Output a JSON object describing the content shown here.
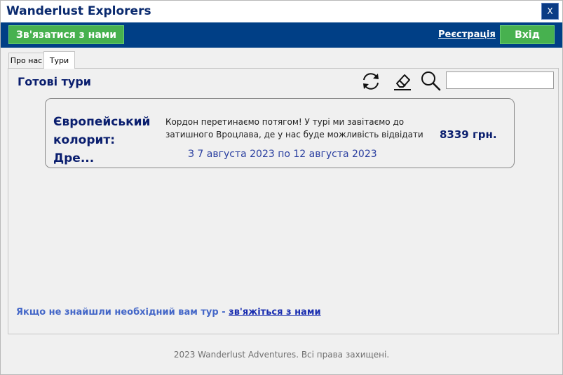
{
  "window": {
    "title": "Wanderlust Explorers",
    "close_label": "X"
  },
  "header": {
    "contact_label": "Зв'язатися з нами",
    "register_label": "Реєстрація",
    "login_label": "Вхід"
  },
  "tabs": [
    {
      "label": "Про нас",
      "selected": false
    },
    {
      "label": "Тури",
      "selected": true
    }
  ],
  "tours_page": {
    "title": "Готові тури",
    "search": {
      "value": "",
      "placeholder": ""
    },
    "icons": [
      "refresh-icon",
      "eraser-icon",
      "search-icon"
    ],
    "tours": [
      {
        "title": "Європейський колорит: Дре...",
        "description": "Кордон перетинаємо потягом! У турі ми завітаємо до затишного Вроцлава, де у нас буде можливість відвідати о...",
        "price": "8339 грн.",
        "dates": "З 7 августа 2023 по 12 августа 2023"
      }
    ],
    "note_text": "Якщо не знайшли необхідний вам тур - ",
    "note_link": "зв'яжіться з нами"
  },
  "footer": {
    "text": "2023 Wanderlust Adventures. Всі права захищені."
  },
  "colors": {
    "header_blue": "#003f86",
    "button_green": "#47b14f",
    "title_navy": "#0a1e6e"
  }
}
